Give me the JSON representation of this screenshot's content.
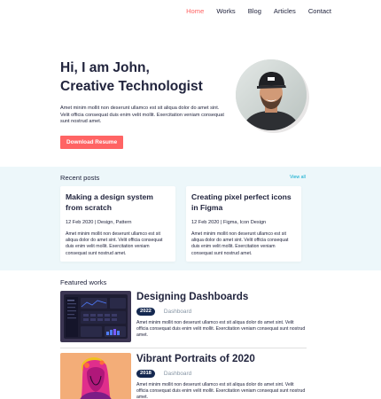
{
  "nav": {
    "items": [
      {
        "label": "Home",
        "active": true
      },
      {
        "label": "Works",
        "active": false
      },
      {
        "label": "Blog",
        "active": false
      },
      {
        "label": "Articles",
        "active": false
      },
      {
        "label": "Contact",
        "active": false
      }
    ]
  },
  "hero": {
    "line1": "Hi, I am John,",
    "line2": "Creative Technologist",
    "body": "Amet minim mollit non deserunt ullamco est sit aliqua dolor do amet sint. Velit officia consequat duis enim velit mollit. Exercitation veniam consequat sunt nostrud amet.",
    "button": "Download Resume"
  },
  "recent": {
    "title": "Recent posts",
    "view_all": "View all",
    "posts": [
      {
        "title": "Making a design system from scratch",
        "meta": "12 Feb 2020 | Design, Pattern",
        "body": "Amet minim mollit non deserunt ullamco est sit aliqua dolor do amet sint. Velit officia consequat duis enim velit mollit. Exercitation veniam consequat sunt nostrud amet."
      },
      {
        "title": "Creating pixel perfect icons in Figma",
        "meta": "12 Feb 2020 | Figma, Icon Design",
        "body": "Amet minim mollit non deserunt ullamco est sit aliqua dolor do amet sint. Velit officia consequat duis enim velit mollit. Exercitation veniam consequat sunt nostrud amet."
      }
    ]
  },
  "featured": {
    "title": "Featured works",
    "works": [
      {
        "title": "Designing Dashboards",
        "year": "2022",
        "category": "Dashboard",
        "body": "Amet minim mollit non deserunt ullamco est sit aliqua dolor do amet sint. Velit officia consequat duis enim velit mollit. Exercitation veniam consequat sunt nostrud amet."
      },
      {
        "title": "Vibrant Portraits of 2020",
        "year": "2018",
        "category": "Dashboard",
        "body": "Amet minim mollit non deserunt ullamco est sit aliqua dolor do amet sint. Velit officia consequat duis enim velit mollit. Exercitation veniam consequat sunt nostrud amet."
      }
    ]
  },
  "colors": {
    "accent": "#ff6464",
    "text": "#21243d",
    "section_bg": "#edf7fa",
    "badge_bg": "#142850",
    "link": "#00a8cc",
    "muted": "#8695a4"
  }
}
